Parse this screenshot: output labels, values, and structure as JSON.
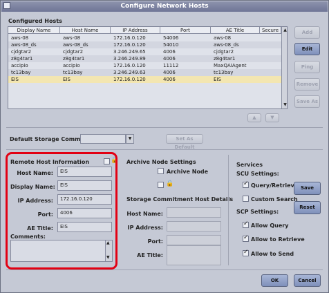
{
  "window": {
    "title": "Configure Network Hosts"
  },
  "configured_hosts": {
    "label": "Configured Hosts",
    "columns": [
      "Display Name",
      "Host Name",
      "IP Address",
      "Port",
      "AE Title",
      "Secure"
    ],
    "rows": [
      [
        "aws-08",
        "aws-08",
        "172.16.0.120",
        "54006",
        "aws-08",
        ""
      ],
      [
        "aws-08_ds",
        "aws-08_ds",
        "172.16.0.120",
        "54010",
        "aws-08_ds",
        ""
      ],
      [
        "cjdgtar2",
        "cjdgtar2",
        "3.246.249.65",
        "4006",
        "cjdgtar2",
        ""
      ],
      [
        "z8g4tar1",
        "z8g4tar1",
        "3.246.249.89",
        "4006",
        "z8g4tar1",
        ""
      ],
      [
        "accipio",
        "accipio",
        "172.16.0.120",
        "11112",
        "MaxQAIAgent",
        ""
      ],
      [
        "tc13bay",
        "tc13bay",
        "3.246.249.63",
        "4006",
        "tc13bay",
        ""
      ],
      [
        "EIS",
        "EIS",
        "172.16.0.120",
        "4006",
        "EIS",
        ""
      ]
    ]
  },
  "side_buttons": {
    "add": "Add",
    "edit": "Edit",
    "ping": "Ping",
    "remove": "Remove",
    "save_as": "Save As"
  },
  "default_commit": {
    "label": "Default Storage Commit Host",
    "value": "",
    "set_default": "Set As Default"
  },
  "remote_host": {
    "label": "Remote Host Information",
    "host_name_label": "Host Name:",
    "host_name": "EIS",
    "display_name_label": "Display Name:",
    "display_name": "EIS",
    "ip_label": "IP Address:",
    "ip": "172.16.0.120",
    "port_label": "Port:",
    "port": "4006",
    "ae_label": "AE Title:",
    "ae": "EIS",
    "comments_label": "Comments:",
    "comments": ""
  },
  "archive": {
    "label": "Archive Node Settings",
    "archive_node": "Archive Node"
  },
  "storage_commit": {
    "label": "Storage Commitment Host Details",
    "host_name_label": "Host Name:",
    "ip_label": "IP Address:",
    "port_label": "Port:",
    "ae_label": "AE Title:"
  },
  "services": {
    "label": "Services",
    "scu_label": "SCU Settings:",
    "query_retrieve": "Query/Retrieve",
    "custom_search": "Custom Search",
    "scp_label": "SCP Settings:",
    "allow_query": "Allow Query",
    "allow_retrieve": "Allow to Retrieve",
    "allow_send": "Allow to Send",
    "save": "Save",
    "reset": "Reset"
  },
  "footer": {
    "ok": "OK",
    "cancel": "Cancel"
  }
}
